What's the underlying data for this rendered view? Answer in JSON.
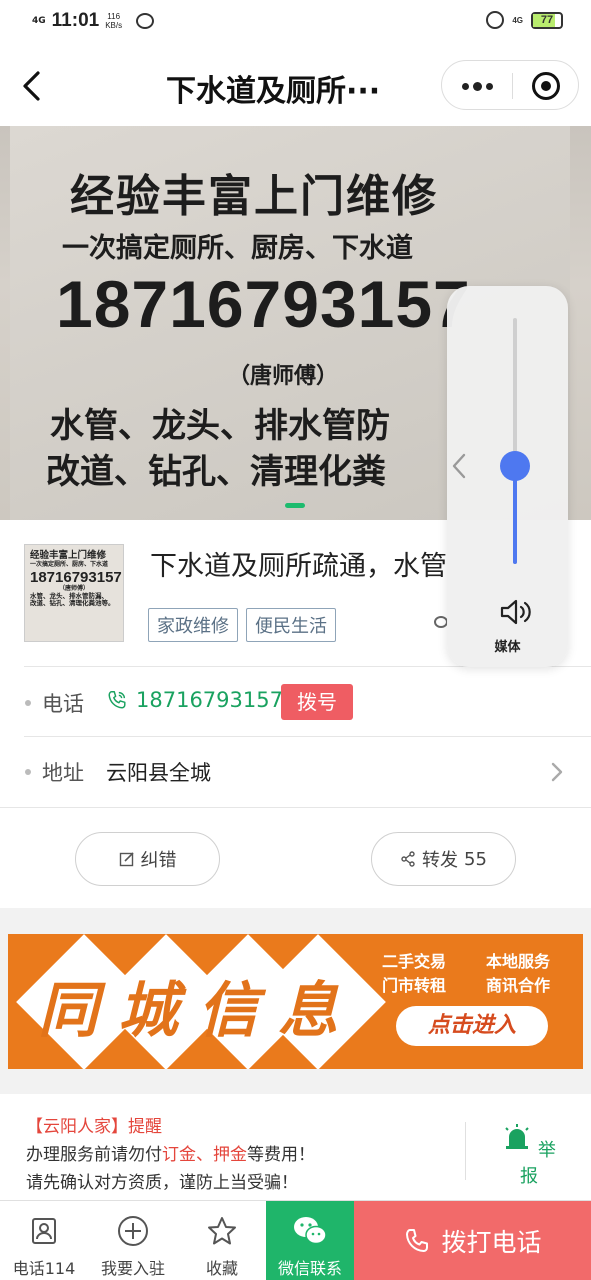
{
  "status_bar": {
    "signal": "4G",
    "time": "11:01",
    "speed_value": "116",
    "speed_unit": "KB/s",
    "network_right": "4G",
    "battery": "77"
  },
  "nav": {
    "title": "下水道及厕所···"
  },
  "banner": {
    "line1": "经验丰富上门维修",
    "line2": "一次搞定厕所、厨房、下水道",
    "line3": "18716793157",
    "line4": "（唐师傅）",
    "line5": "水管、龙头、排水管防",
    "line6": "改道、钻孔、清理化粪"
  },
  "thumb": {
    "line1": "经验丰富上门维修",
    "line2": "一次搞定厕所、厨房、下水道",
    "line3": "18716793157",
    "line4": "（唐师傅）",
    "line5": "水管、龙头、排水管防漏、",
    "line6": "改道、钻孔、清理化粪池等。"
  },
  "volume": {
    "level": 0.4,
    "label": "媒体"
  },
  "post": {
    "title": "下水道及厕所疏通，水管",
    "tags": [
      "家政维修",
      "便民生活"
    ],
    "phone_label": "电话",
    "phone": "18716793157",
    "dial_label": "拨号",
    "address_label": "地址",
    "address": "云阳县全城",
    "correct_label": "纠错",
    "share_label": "转发",
    "share_count": "55"
  },
  "ad": {
    "big_text": "同城信息",
    "item1": "二手交易",
    "item2": "本地服务",
    "item3": "门市转租",
    "item4": "商讯合作",
    "enter": "点击进入"
  },
  "notice": {
    "bracket_open": "【",
    "site": "云阳人家",
    "bracket_close": "】",
    "remind": "提醒",
    "line2_a": "办理服务前请勿付",
    "line2_b": "订金、押金",
    "line2_c": "等费用！",
    "line3": "请先确认对方资质，谨防上当受骗！",
    "report": "举报"
  },
  "tabbar": {
    "phone114": "电话114",
    "join": "我要入驻",
    "favorite": "收藏",
    "wechat": "微信联系",
    "call": "拨打电话"
  },
  "colors": {
    "green": "#1aa260",
    "red": "#ef5d63",
    "orange": "#ea7a1c",
    "blue": "#4e78f0"
  }
}
